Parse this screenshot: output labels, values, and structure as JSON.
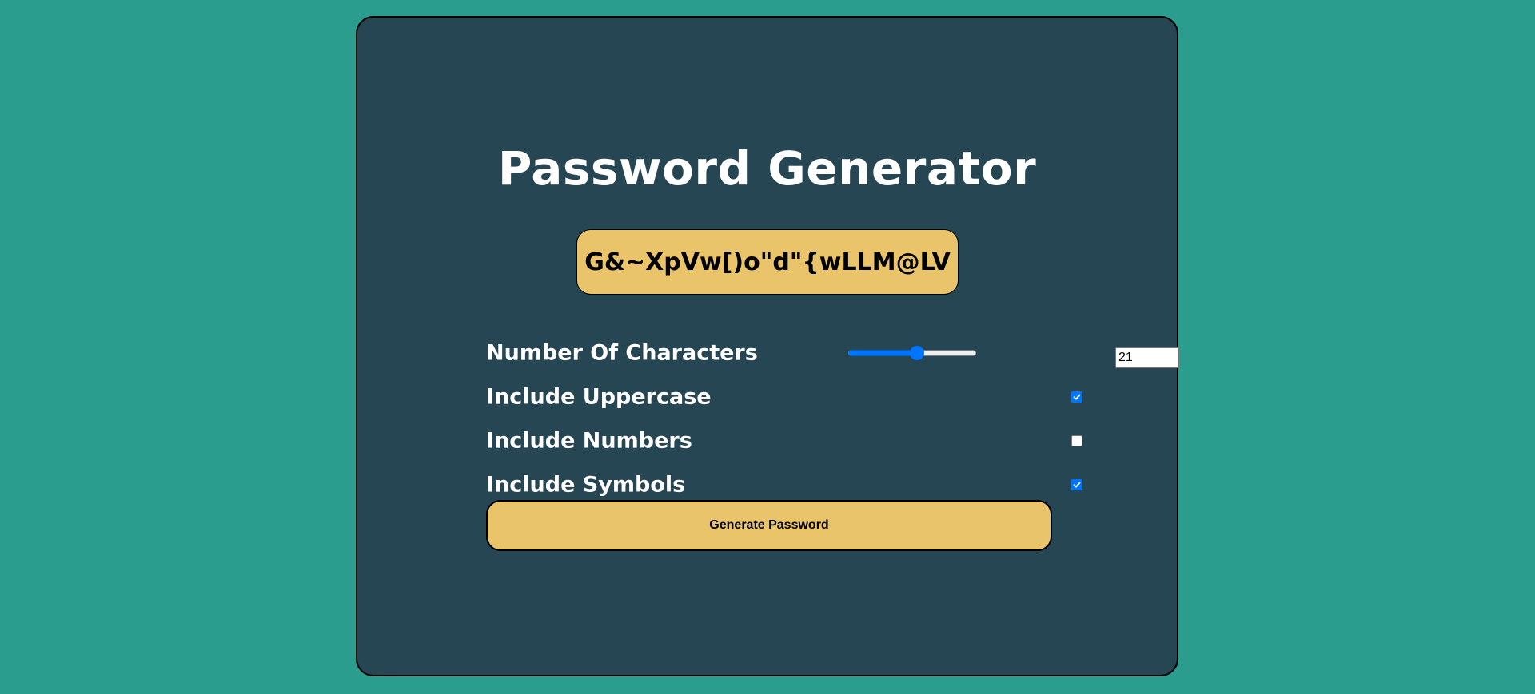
{
  "app": {
    "title": "Password Generator"
  },
  "password": {
    "value": "G&~XpVw[)o\"d\"{wLLM@LV"
  },
  "options": {
    "length": {
      "label": "Number Of Characters",
      "value": "21",
      "min": 8,
      "max": 32
    },
    "uppercase": {
      "label": "Include Uppercase",
      "checked": true
    },
    "numbers": {
      "label": "Include Numbers",
      "checked": false
    },
    "symbols": {
      "label": "Include Symbols",
      "checked": true
    }
  },
  "actions": {
    "generate_label": "Generate Password"
  },
  "colors": {
    "page_background": "#2a9d8f",
    "card_background": "#264653",
    "accent": "#e9c46a",
    "control_blue": "#0075ff"
  }
}
